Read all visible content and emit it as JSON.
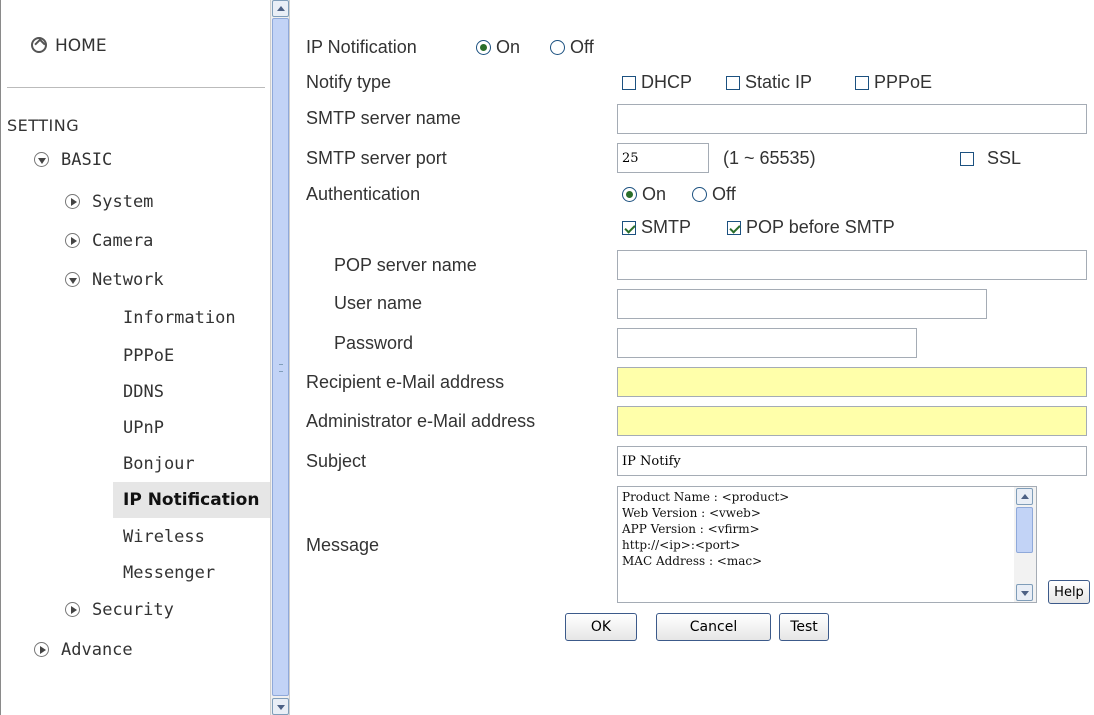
{
  "nav": {
    "home": "HOME",
    "setting": "SETTING",
    "basic": "BASIC",
    "items": {
      "system": "System",
      "camera": "Camera",
      "network": "Network",
      "information": "Information",
      "pppoe": "PPPoE",
      "ddns": "DDNS",
      "upnp": "UPnP",
      "bonjour": "Bonjour",
      "ip_notification": "IP Notification",
      "wireless": "Wireless",
      "messenger": "Messenger",
      "security": "Security",
      "advance": "Advance"
    },
    "active_item": "IP Notification"
  },
  "form": {
    "ip_notification": {
      "label": "IP Notification",
      "on": "On",
      "off": "Off",
      "selected": "On"
    },
    "notify_type": {
      "label": "Notify type",
      "dhcp": "DHCP",
      "static_ip": "Static IP",
      "pppoe": "PPPoE"
    },
    "smtp_server_name": {
      "label": "SMTP server name",
      "value": ""
    },
    "smtp_server_port": {
      "label": "SMTP server port",
      "value": "25",
      "range": "(1 ~ 65535)",
      "ssl": "SSL"
    },
    "authentication": {
      "label": "Authentication",
      "on": "On",
      "off": "Off",
      "selected": "On",
      "smtp": "SMTP",
      "pop_before_smtp": "POP before SMTP"
    },
    "pop_server_name": {
      "label": "POP server name",
      "value": ""
    },
    "user_name": {
      "label": "User name",
      "value": ""
    },
    "password": {
      "label": "Password",
      "value": ""
    },
    "recipient_email": {
      "label": "Recipient e-Mail address",
      "value": ""
    },
    "admin_email": {
      "label": "Administrator e-Mail address",
      "value": ""
    },
    "subject": {
      "label": "Subject",
      "value": "IP Notify"
    },
    "message": {
      "label": "Message",
      "value": "Product Name : <product>\nWeb Version : <vweb>\nAPP Version : <vfirm>\nhttp://<ip>:<port>\nMAC Address : <mac>"
    },
    "buttons": {
      "help": "Help",
      "ok": "OK",
      "cancel": "Cancel",
      "test": "Test"
    }
  },
  "colors": {
    "required_field": "#ffffaa",
    "active_nav": "#e6e6e6",
    "scrollbar_thumb": "#c2d3f6"
  }
}
